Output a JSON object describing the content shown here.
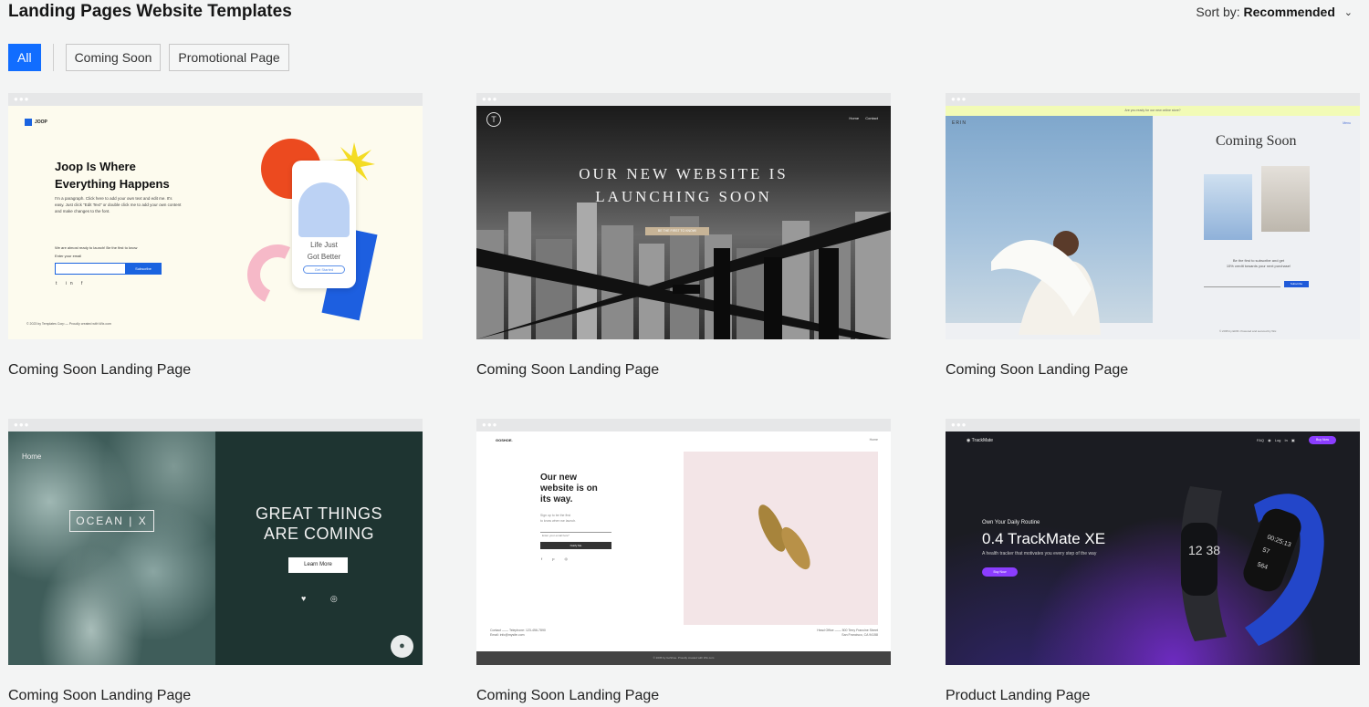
{
  "page": {
    "title": "Landing Pages Website Templates",
    "sort_label": "Sort by:",
    "sort_value": "Recommended"
  },
  "filters": [
    {
      "label": "All",
      "active": true
    },
    {
      "label": "Coming Soon",
      "active": false
    },
    {
      "label": "Promotional Page",
      "active": false
    }
  ],
  "cards": [
    {
      "title": "Coming Soon Landing Page",
      "thumb": {
        "logo": "JOOP",
        "heading_line1": "Joop Is Where",
        "heading_line2": "Everything Happens",
        "paragraph": "I'm a paragraph. Click here to add your own text and edit me. It's easy. Just click \"Edit Text\" or double click me to add your own content and make changes to the font.",
        "note": "We are almost ready to launch! Be the first to know",
        "email_label": "Enter your email",
        "subscribe": "Subscribe",
        "socials": "t in f",
        "footer": "© 2023 by Templates Corp — Proudly created with Wix.com",
        "phone_line1": "Life Just",
        "phone_line2": "Got Better",
        "phone_button": "Get Started"
      }
    },
    {
      "title": "Coming Soon Landing Page",
      "thumb": {
        "logo_letter": "T",
        "nav": "Home Contact",
        "heading_line1": "OUR NEW WEBSITE IS",
        "heading_line2": "LAUNCHING SOON",
        "button": "BE THE FIRST TO KNOW!"
      }
    },
    {
      "title": "Coming Soon Landing Page",
      "thumb": {
        "topbar": "Are you ready for our new online store?",
        "brand": "ERIN",
        "menu": "Menu",
        "heading": "Coming Soon",
        "text_line1": "Be the first to subscribe and get",
        "text_line2": "15% credit towards your next purchase!",
        "email_label": "Email *",
        "subscribe": "Subscribe",
        "footer": "© 2035 by ERIN. Powered and secured by Wix"
      }
    },
    {
      "title": "Coming Soon Landing Page",
      "thumb": {
        "home": "Home",
        "logo": "OCEAN | X",
        "heading_line1": "GREAT THINGS",
        "heading_line2": "ARE COMING",
        "button": "Learn More",
        "socials": "♥ ◎",
        "chat": "●"
      }
    },
    {
      "title": "Coming Soon Landing Page",
      "thumb": {
        "logo": "GOSHOE.",
        "menu": "Home",
        "heading_line1": "Our new",
        "heading_line2": "website is on",
        "heading_line3": "its way.",
        "signup_line1": "Sign up to be the first",
        "signup_line2": "to know when we launch.",
        "field_label": "Enter your email here*",
        "button": "Notify Me",
        "socials": "f p ◎",
        "contact_line1": "Contact —— Telephone: 123-456-7890",
        "contact_line2": "Email: info@mysite.com",
        "address_line1": "Head Office —— 500 Terry Francine Street",
        "address_line2": "San Francisco, CA 94158",
        "footer": "© 2035 by GoShoe. Proudly created with Wix.com"
      }
    },
    {
      "title": "Product Landing Page",
      "thumb": {
        "logo": "◉ TrackMate",
        "nav": "FAQ ◉ Log In ▣",
        "buy_top": "Buy Now",
        "subheading": "Own Your Daily Routine",
        "heading": "0.4 TrackMate XE",
        "tagline": "A health tracker that motivates you every step of the way",
        "button": "Buy Now",
        "watch_time": "12 38",
        "watch_clock": "00:25:13",
        "watch_stat1": "57",
        "watch_stat2": "564"
      }
    }
  ]
}
